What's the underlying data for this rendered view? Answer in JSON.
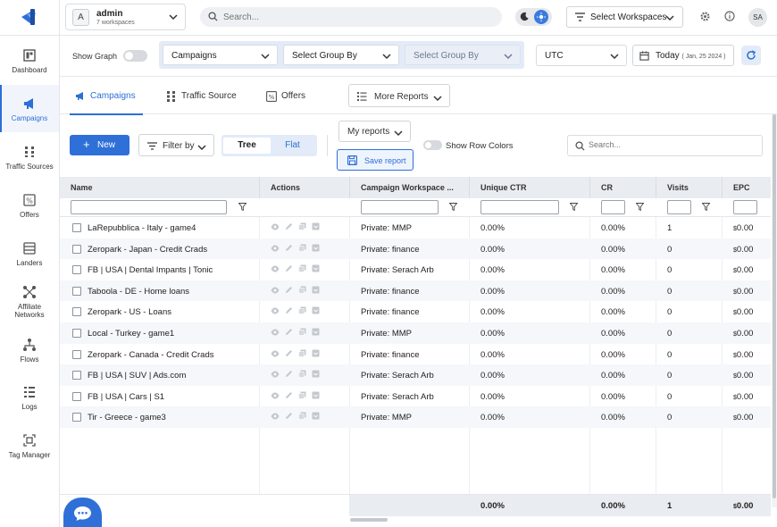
{
  "sidebar": {
    "items": [
      {
        "label": "Dashboard",
        "icon": "dashboard-icon"
      },
      {
        "label": "Campaigns",
        "icon": "megaphone-icon",
        "active": true
      },
      {
        "label": "Traffic Sources",
        "icon": "traffic-icon"
      },
      {
        "label": "Offers",
        "icon": "percent-icon"
      },
      {
        "label": "Landers",
        "icon": "layout-icon"
      },
      {
        "label": "Affiliate",
        "label2": "Networks",
        "icon": "network-icon"
      },
      {
        "label": "Flows",
        "icon": "flow-icon"
      },
      {
        "label": "Logs",
        "icon": "list-icon"
      },
      {
        "label": "Tag Manager",
        "icon": "tag-icon"
      }
    ]
  },
  "header": {
    "workspace": {
      "avatar": "A",
      "name": "admin",
      "sub": "7 workspaces"
    },
    "search_placeholder": "Search...",
    "select_workspaces": "Select Workspaces",
    "user_initials": "SA",
    "accent": "#2c6fd6"
  },
  "toolbar": {
    "show_graph": "Show Graph",
    "group1": "Campaigns",
    "group2": "Select Group By",
    "group3": "Select Group By",
    "timezone": "UTC",
    "date_label": "Today",
    "date_sub": "( Jan, 25 2024 )"
  },
  "tabs": {
    "campaigns": "Campaigns",
    "traffic_source": "Traffic Source",
    "offers": "Offers",
    "more_reports": "More Reports"
  },
  "actions": {
    "new": "New",
    "filter_by": "Filter by",
    "tree": "Tree",
    "flat": "Flat",
    "my_reports": "My reports",
    "save_report": "Save report",
    "show_row_colors": "Show Row Colors",
    "search_placeholder": "Search..."
  },
  "table": {
    "columns": [
      "Name",
      "Actions",
      "Campaign Workspace ...",
      "Unique CTR",
      "CR",
      "Visits",
      "EPC"
    ],
    "rows": [
      {
        "name": "LaRepubblica - Italy - game4",
        "workspace": "Private: MMP",
        "ctr": "0.00%",
        "cr": "0.00%",
        "visits": "1",
        "epc": "0.00"
      },
      {
        "name": "Zeropark - Japan - Credit Crads",
        "workspace": "Private: finance",
        "ctr": "0.00%",
        "cr": "0.00%",
        "visits": "0",
        "epc": "0.00"
      },
      {
        "name": "FB | USA | Dental Impants | Tonic",
        "workspace": "Private: Serach Arb",
        "ctr": "0.00%",
        "cr": "0.00%",
        "visits": "0",
        "epc": "0.00"
      },
      {
        "name": "Taboola - DE - Home loans",
        "workspace": "Private: finance",
        "ctr": "0.00%",
        "cr": "0.00%",
        "visits": "0",
        "epc": "0.00"
      },
      {
        "name": "Zeropark - US - Loans",
        "workspace": "Private: finance",
        "ctr": "0.00%",
        "cr": "0.00%",
        "visits": "0",
        "epc": "0.00"
      },
      {
        "name": "Local - Turkey - game1",
        "workspace": "Private: MMP",
        "ctr": "0.00%",
        "cr": "0.00%",
        "visits": "0",
        "epc": "0.00"
      },
      {
        "name": "Zeropark - Canada - Credit Crads",
        "workspace": "Private: finance",
        "ctr": "0.00%",
        "cr": "0.00%",
        "visits": "0",
        "epc": "0.00"
      },
      {
        "name": "FB | USA | SUV | Ads.com",
        "workspace": "Private: Serach Arb",
        "ctr": "0.00%",
        "cr": "0.00%",
        "visits": "0",
        "epc": "0.00"
      },
      {
        "name": "FB | USA | Cars | S1",
        "workspace": "Private: Serach Arb",
        "ctr": "0.00%",
        "cr": "0.00%",
        "visits": "0",
        "epc": "0.00"
      },
      {
        "name": "Tir - Greece - game3",
        "workspace": "Private: MMP",
        "ctr": "0.00%",
        "cr": "0.00%",
        "visits": "0",
        "epc": "0.00"
      }
    ],
    "currency": "$",
    "totals": {
      "ctr": "0.00%",
      "cr": "0.00%",
      "visits": "1",
      "epc": "0.00"
    }
  }
}
